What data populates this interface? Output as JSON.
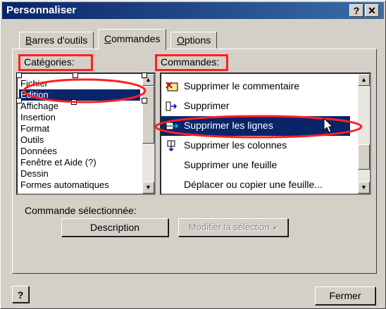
{
  "window": {
    "title": "Personnaliser",
    "help_glyph": "?",
    "close_glyph": "✕"
  },
  "tabs": [
    {
      "label": "Barres d'outils",
      "underline": "B",
      "rest": "arres d'outils"
    },
    {
      "label": "Commandes",
      "underline": "C",
      "rest": "ommandes"
    },
    {
      "label": "Options",
      "underline": "O",
      "rest": "ptions"
    }
  ],
  "categories": {
    "label": "Catégories:",
    "items": [
      "Fichier",
      "Edition",
      "Affichage",
      "Insertion",
      "Format",
      "Outils",
      "Données",
      "Fenêtre et Aide (?)",
      "Dessin",
      "Formes automatiques"
    ],
    "selected": "Edition"
  },
  "commands": {
    "label": "Commandes:",
    "items": [
      {
        "label": "Supprimer le commentaire",
        "icon": "delete-comment-icon"
      },
      {
        "label": "Supprimer",
        "icon": "delete-icon"
      },
      {
        "label": "Supprimer les lignes",
        "icon": "delete-rows-icon"
      },
      {
        "label": "Supprimer les colonnes",
        "icon": "delete-columns-icon"
      },
      {
        "label": "Supprimer une feuille",
        "icon": ""
      },
      {
        "label": "Déplacer ou copier une feuille...",
        "icon": ""
      }
    ],
    "selected": "Supprimer les lignes"
  },
  "selected_command": {
    "label": "Commande sélectionnée:",
    "description_button": "Description",
    "modify_button": "Modifier la sélection"
  },
  "footer": {
    "close_button": "Fermer"
  },
  "colors": {
    "highlight": "#0a246a",
    "annotation": "#ff2020",
    "face": "#d4d0c8"
  }
}
